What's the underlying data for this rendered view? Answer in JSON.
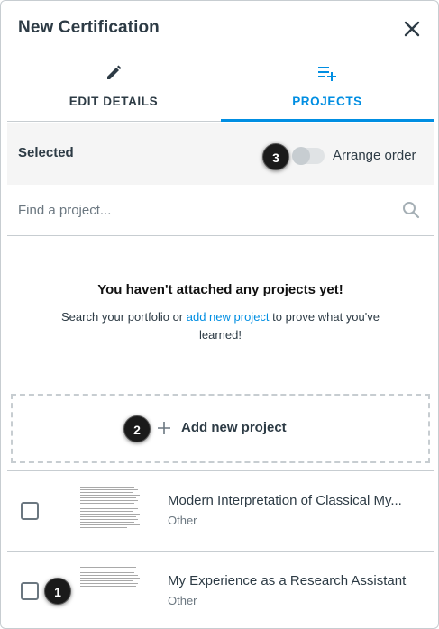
{
  "header": {
    "title": "New Certification"
  },
  "tabs": [
    {
      "label": "EDIT DETAILS",
      "icon": "pencil-icon",
      "active": false
    },
    {
      "label": "PROJECTS",
      "icon": "playlist-add-icon",
      "active": true
    }
  ],
  "selected_bar": {
    "label": "Selected",
    "toggle_label": "Arrange order",
    "toggle_on": false
  },
  "search": {
    "placeholder": "Find a project..."
  },
  "empty_state": {
    "heading": "You haven't attached any projects yet!",
    "text_before": "Search your portfolio or ",
    "link": "add new project",
    "text_after": " to prove what you've learned!"
  },
  "add_project": {
    "label": "Add new project"
  },
  "projects": [
    {
      "title": "Modern Interpretation of Classical My...",
      "category": "Other",
      "checked": false
    },
    {
      "title": "My Experience as a Research Assistant",
      "category": "Other",
      "checked": false
    }
  ],
  "badges": {
    "toggle": "3",
    "add": "2",
    "checkbox": "1"
  },
  "colors": {
    "accent": "#008ee2",
    "text": "#2d3b45",
    "border": "#c7cdd1",
    "muted": "#6b7780"
  }
}
